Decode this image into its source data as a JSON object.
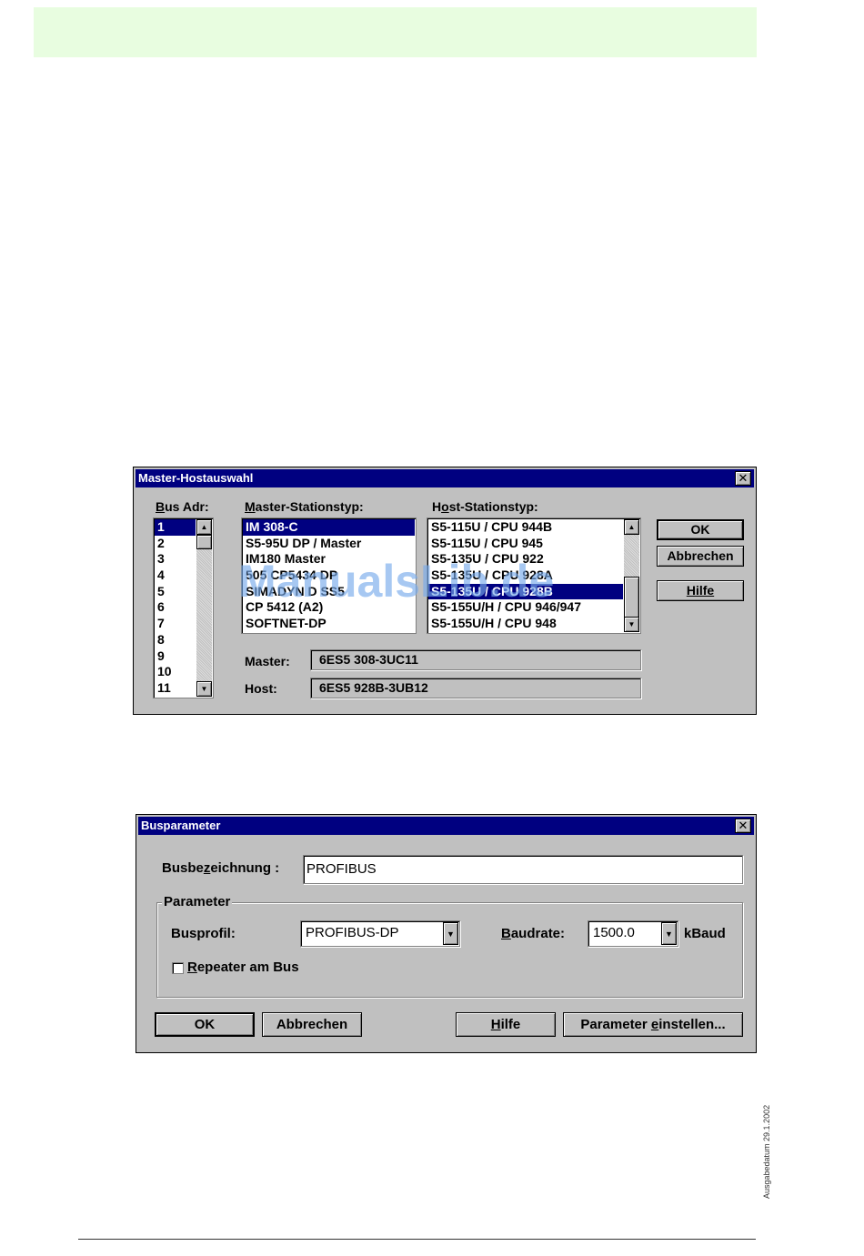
{
  "footer": {
    "edition_date": "Ausgabedatum 29.1.2002"
  },
  "watermark": "ManualsLib.de",
  "master_host_dialog": {
    "title": "Master-Hostauswahl",
    "close_label": "✕",
    "bus_adr_label": {
      "prefix": "",
      "accel": "B",
      "rest": "us Adr:"
    },
    "bus_addresses": [
      "1",
      "2",
      "3",
      "4",
      "5",
      "6",
      "7",
      "8",
      "9",
      "10",
      "11"
    ],
    "bus_selected": "1",
    "master_label": {
      "prefix": "",
      "accel": "M",
      "rest": "aster-Stationstyp:"
    },
    "master_types": [
      "IM 308-C",
      "S5-95U DP / Master",
      "IM180 Master",
      "505 CP5434 DP",
      "SIMADYN D SS5",
      "CP 5412 (A2)",
      "SOFTNET-DP"
    ],
    "master_selected": "IM 308-C",
    "host_label": {
      "prefix": "H",
      "accel": "o",
      "rest": "st-Stationstyp:"
    },
    "host_types": [
      "S5-115U / CPU 944B",
      "S5-115U / CPU 945",
      "S5-135U / CPU 922",
      "S5-135U / CPU 928A",
      "S5-135U / CPU 928B",
      "S5-155U/H / CPU 946/947",
      "S5-155U/H / CPU 948"
    ],
    "host_selected": "S5-135U / CPU 928B",
    "ok_label": "OK",
    "cancel_label": "Abbrechen",
    "help_label": "Hilfe",
    "master_field_label": "Master:",
    "master_value": "6ES5 308-3UC11",
    "host_field_label": "Host:",
    "host_value": "6ES5 928B-3UB12"
  },
  "bus_param_dialog": {
    "title": "Busparameter",
    "close_label": "✕",
    "busname_label": {
      "prefix": "Busbe",
      "accel": "z",
      "rest": "eichnung :"
    },
    "busname_value": "PROFIBUS",
    "group_title": "Parameter",
    "busprofile_label": "Busprofil:",
    "busprofile_value": "PROFIBUS-DP",
    "baudrate_label": {
      "prefix": "",
      "accel": "B",
      "rest": "audrate:"
    },
    "baudrate_value": "1500.0",
    "baudrate_unit": "kBaud",
    "repeater_label": {
      "prefix": "",
      "accel": "R",
      "rest": "epeater am Bus"
    },
    "repeater_checked": false,
    "ok_label": "OK",
    "cancel_label": "Abbrechen",
    "help_label": {
      "prefix": "",
      "accel": "H",
      "rest": "ilfe"
    },
    "set_params_label": {
      "prefix": "Parameter ",
      "accel": "e",
      "rest": "instellen..."
    }
  }
}
